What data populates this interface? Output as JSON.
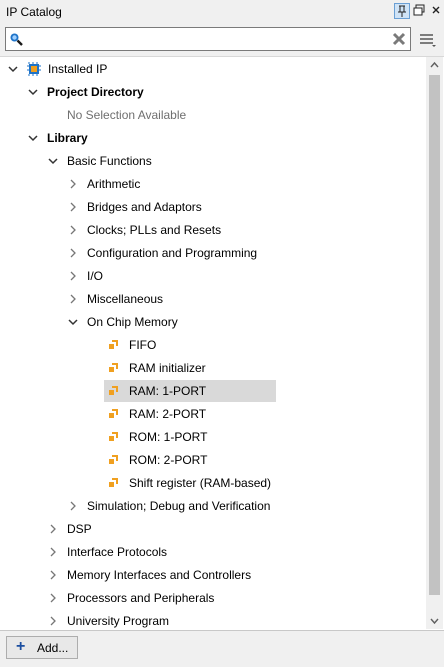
{
  "panel": {
    "title": "IP Catalog"
  },
  "search": {
    "placeholder": ""
  },
  "tree": {
    "root": "Installed IP",
    "project_directory": "Project Directory",
    "no_selection": "No Selection Available",
    "library": "Library",
    "basic_functions": "Basic Functions",
    "basic_children": [
      "Arithmetic",
      "Bridges and Adaptors",
      "Clocks; PLLs and Resets",
      "Configuration and Programming",
      "I/O",
      "Miscellaneous"
    ],
    "on_chip_memory": "On Chip Memory",
    "memory_items": [
      "FIFO",
      "RAM initializer",
      "RAM: 1-PORT",
      "RAM: 2-PORT",
      "ROM: 1-PORT",
      "ROM: 2-PORT",
      "Shift register (RAM-based)"
    ],
    "selected_item": "RAM: 1-PORT",
    "simulation": "Simulation; Debug and Verification",
    "library_children": [
      "DSP",
      "Interface Protocols",
      "Memory Interfaces and Controllers",
      "Processors and Peripherals",
      "University Program"
    ]
  },
  "footer": {
    "add_label": "Add..."
  },
  "colors": {
    "ip_icon": "#f0a020",
    "accent": "#1c4fa0",
    "selection": "#d9d9d9"
  }
}
